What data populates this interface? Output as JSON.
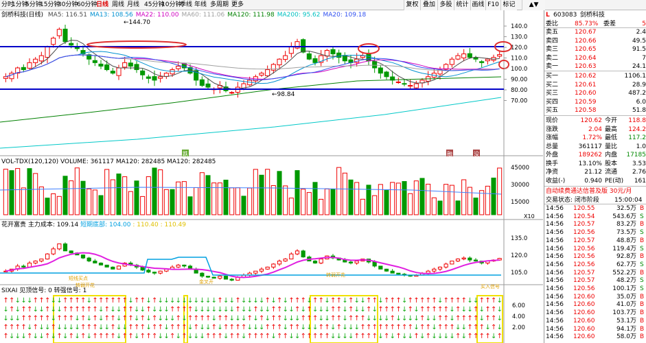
{
  "toolbar": {
    "tabs": [
      "分时",
      "1分钟",
      "5分钟",
      "15分钟",
      "30分钟",
      "60分钟",
      "日线",
      "周线",
      "月线",
      "45分钟",
      "10分钟",
      "季线",
      "年线",
      "多周期",
      "更多"
    ],
    "active": "日线",
    "right": [
      "复权",
      "叠加",
      "多股",
      "统计",
      "画线",
      "F10",
      "标记"
    ]
  },
  "main": {
    "title": "剑桥科技(日线)",
    "ma": [
      {
        "label": "MA5: 116.51",
        "color": "#4b4b4b"
      },
      {
        "label": "MA13: 108.56",
        "color": "#0090d0"
      },
      {
        "label": "MA22: 110.00",
        "color": "#d000c0"
      },
      {
        "label": "MA60: 111.06",
        "color": "#a0a0a0"
      },
      {
        "label": "MA120: 111.98",
        "color": "#008000"
      },
      {
        "label": "MA200: 95.62",
        "color": "#00c0c0"
      },
      {
        "label": "MA20: 109.18",
        "color": "#3050f0"
      }
    ],
    "y_ticks": [
      "140.0",
      "130.0",
      "120.0",
      "110.0",
      "100.0",
      "90.00",
      "80.00",
      "70.00"
    ],
    "high_label": "144.70",
    "low_label": "98.84",
    "markers": [
      "跌",
      "融",
      "没"
    ]
  },
  "vol": {
    "label": "VOL-TDX(120,120) VOLUME: 361117  MA120: 282485  MA120: 282485",
    "y_ticks": [
      "45000",
      "30000",
      "15000"
    ],
    "unit": "X10"
  },
  "hk": {
    "label_a": "花开富贵  主力成本: 109.14  ",
    "label_b": "短期底部: 104.00",
    "label_c": " : 110.40 : 110.49",
    "y_ticks": [
      "135.0",
      "120.0",
      "105.0"
    ],
    "notes": [
      "短线买点",
      "转弱开花",
      "金叉开",
      "转弱开花",
      "买入信号"
    ]
  },
  "sx": {
    "label": "SIXAI  见顶信号: 0   转强信号: 1",
    "y_ticks": [
      "6.00",
      "4.00",
      "2.00"
    ]
  },
  "quote": {
    "code": "603083",
    "name": "剑桥科技",
    "wb": {
      "l1": "委比",
      "v1": "85.73%",
      "l2": "委差",
      "v2": "5"
    },
    "asks": [
      {
        "l": "卖五",
        "p": "120.67",
        "v": "2.4"
      },
      {
        "l": "卖四",
        "p": "120.66",
        "v": "49.5"
      },
      {
        "l": "卖三",
        "p": "120.65",
        "v": "91.5"
      },
      {
        "l": "卖二",
        "p": "120.64",
        "v": "7"
      },
      {
        "l": "卖一",
        "p": "120.63",
        "v": "24.1"
      }
    ],
    "bids": [
      {
        "l": "买一",
        "p": "120.62",
        "v": "1106.1"
      },
      {
        "l": "买二",
        "p": "120.61",
        "v": "28.9"
      },
      {
        "l": "买三",
        "p": "120.60",
        "v": "487.2"
      },
      {
        "l": "买四",
        "p": "120.59",
        "v": "6.0"
      },
      {
        "l": "买五",
        "p": "120.58",
        "v": "51.8"
      }
    ],
    "stats": [
      {
        "l1": "现价",
        "v1": "120.62",
        "c1": "red",
        "l2": "今开",
        "v2": "118.8",
        "c2": "red"
      },
      {
        "l1": "涨跌",
        "v1": "2.04",
        "c1": "red",
        "l2": "最高",
        "v2": "124.2",
        "c2": "red"
      },
      {
        "l1": "涨幅",
        "v1": "1.72%",
        "c1": "red",
        "l2": "最低",
        "v2": "117.2",
        "c2": "grn"
      },
      {
        "l1": "总量",
        "v1": "361117",
        "c1": "blk",
        "l2": "量比",
        "v2": "1.0",
        "c2": "blk"
      },
      {
        "l1": "外盘",
        "v1": "189262",
        "c1": "red",
        "l2": "内盘",
        "v2": "17185",
        "c2": "grn"
      },
      {
        "l1": "换手",
        "v1": "13.10%",
        "c1": "blk",
        "l2": "股本",
        "v2": "3.53",
        "c2": "blk"
      },
      {
        "l1": "净资",
        "v1": "21.12",
        "c1": "blk",
        "l2": "流通",
        "v2": "2.76",
        "c2": "blk"
      },
      {
        "l1": "收益(-)",
        "v1": "0.940",
        "c1": "blk",
        "l2": "PE(动)",
        "v2": "161",
        "c2": "blk"
      }
    ],
    "promo": "自动续费通达信普及版  30元/月",
    "status_label": "交易状态: 闭市阶段",
    "status_time": "15:00:04",
    "ticks": [
      {
        "t": "14:56",
        "p": "120.55",
        "v": "32.5万",
        "s": "B"
      },
      {
        "t": "14:56",
        "p": "120.54",
        "v": "543.6万",
        "s": "S"
      },
      {
        "t": "14:56",
        "p": "120.57",
        "v": "83.2万",
        "s": "B"
      },
      {
        "t": "14:56",
        "p": "120.56",
        "v": "73.5万",
        "s": "S"
      },
      {
        "t": "14:56",
        "p": "120.57",
        "v": "48.8万",
        "s": "B"
      },
      {
        "t": "14:56",
        "p": "120.56",
        "v": "119.4万",
        "s": "S"
      },
      {
        "t": "14:56",
        "p": "120.56",
        "v": "92.8万",
        "s": "B"
      },
      {
        "t": "14:56",
        "p": "120.56",
        "v": "62.7万",
        "s": "S"
      },
      {
        "t": "14:56",
        "p": "120.57",
        "v": "552.2万",
        "s": "B"
      },
      {
        "t": "14:56",
        "p": "120.57",
        "v": "48.2万",
        "s": "S"
      },
      {
        "t": "14:56",
        "p": "120.56",
        "v": "100.1万",
        "s": "S"
      },
      {
        "t": "14:56",
        "p": "120.60",
        "v": "35.0万",
        "s": "B"
      },
      {
        "t": "14:56",
        "p": "120.60",
        "v": "41.0万",
        "s": "B"
      },
      {
        "t": "14:56",
        "p": "120.60",
        "v": "103.7万",
        "s": "B"
      },
      {
        "t": "14:56",
        "p": "120.60",
        "v": "53.1万",
        "s": "B"
      },
      {
        "t": "14:56",
        "p": "120.60",
        "v": "94.1万",
        "s": "B"
      },
      {
        "t": "14:56",
        "p": "120.60",
        "v": "58.0万",
        "s": "B"
      }
    ]
  }
}
